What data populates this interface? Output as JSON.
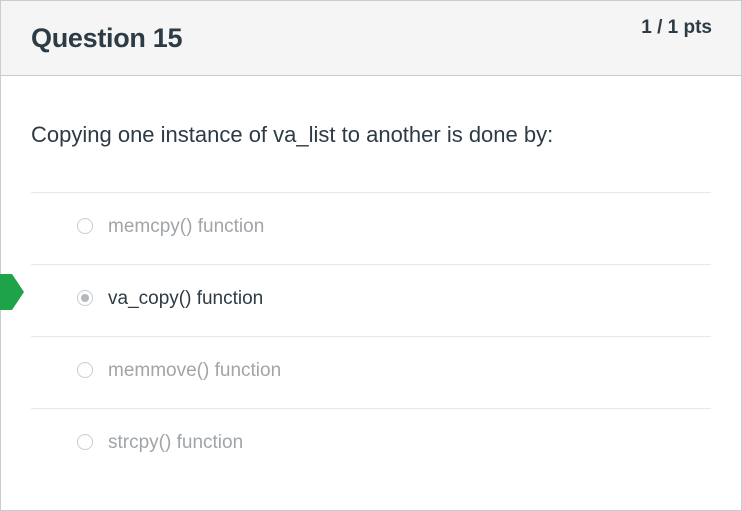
{
  "question": {
    "title": "Question 15",
    "points": "1 / 1 pts",
    "text": "Copying one instance of va_list to another is done by:"
  },
  "answers": [
    {
      "label": "memcpy() function",
      "selected": false
    },
    {
      "label": "va_copy() function",
      "selected": true
    },
    {
      "label": "memmove() function",
      "selected": false
    },
    {
      "label": "strcpy() function",
      "selected": false
    }
  ],
  "colors": {
    "correct_arrow": "#1ea34a",
    "text": "#2d3b45",
    "muted_text": "#a0a5a9"
  },
  "icons": {
    "correct_marker": "correct-answer-arrow-icon"
  }
}
